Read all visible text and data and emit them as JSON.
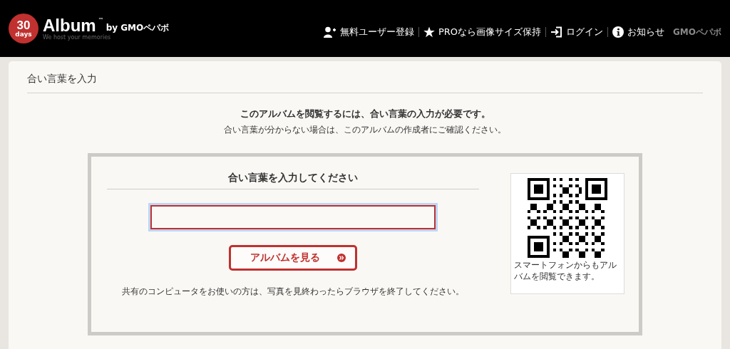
{
  "header": {
    "logo": {
      "number": "30",
      "unit": "days",
      "name": "Album",
      "trademark": "™",
      "by": "by GMOペパボ",
      "tagline": "We host your memories"
    },
    "nav": [
      {
        "kind": "user-add",
        "label": "無料ユーザー登録"
      },
      {
        "kind": "star",
        "label": "PROなら画像サイズ保持"
      },
      {
        "kind": "login",
        "label": "ログイン"
      },
      {
        "kind": "info",
        "label": "お知らせ"
      }
    ],
    "brand": "GMOペパボ"
  },
  "panel": {
    "title": "合い言葉を入力",
    "message": "このアルバムを閲覧するには、合い言葉の入力が必要です。",
    "hint": "合い言葉が分からない場合は、このアルバムの作成者にご確認ください。",
    "form": {
      "title": "合い言葉を入力してください",
      "button": "アルバムを見る",
      "notice": "共有のコンピュータをお使いの方は、写真を見終わったらブラウザを終了してください。"
    },
    "qr": {
      "caption": "スマートフォンからもアルバムを閲覧できます。"
    }
  }
}
